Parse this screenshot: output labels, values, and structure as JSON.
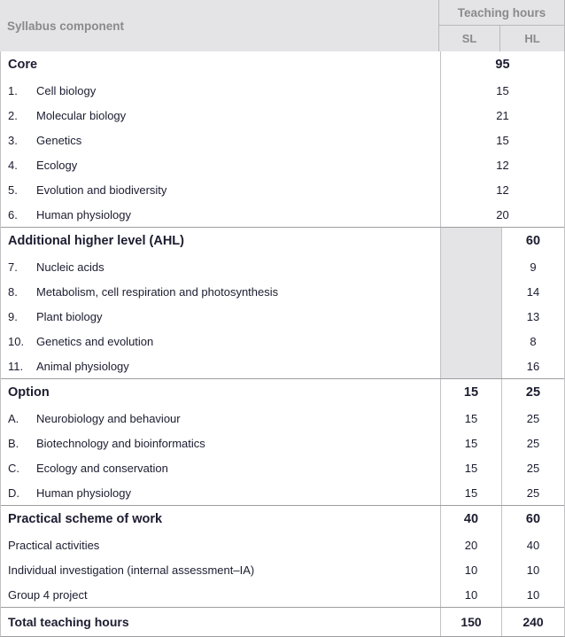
{
  "header": {
    "component_label": "Syllabus component",
    "hours_label": "Teaching hours",
    "sl_label": "SL",
    "hl_label": "HL"
  },
  "colors": {
    "header_bg": "#e4e4e6",
    "header_text": "#8a8a8a",
    "body_text": "#1c1c30",
    "border": "#9e9ea0",
    "shaded_cell": "#e4e4e6"
  },
  "sections": [
    {
      "title": "Core",
      "merged_value": "95",
      "sl_total": "",
      "hl_total": "",
      "sl_shaded": false,
      "items": [
        {
          "index": "1.",
          "label": "Cell biology",
          "merged": "15"
        },
        {
          "index": "2.",
          "label": "Molecular biology",
          "merged": "21"
        },
        {
          "index": "3.",
          "label": "Genetics",
          "merged": "15"
        },
        {
          "index": "4.",
          "label": "Ecology",
          "merged": "12"
        },
        {
          "index": "5.",
          "label": "Evolution and biodiversity",
          "merged": "12"
        },
        {
          "index": "6.",
          "label": "Human physiology",
          "merged": "20"
        }
      ]
    },
    {
      "title": "Additional higher level (AHL)",
      "merged_value": "",
      "sl_total": "",
      "hl_total": "60",
      "sl_shaded": true,
      "items": [
        {
          "index": "7.",
          "label": "Nucleic acids",
          "sl": "",
          "hl": "9"
        },
        {
          "index": "8.",
          "label": "Metabolism, cell respiration and photosynthesis",
          "sl": "",
          "hl": "14"
        },
        {
          "index": "9.",
          "label": "Plant biology",
          "sl": "",
          "hl": "13"
        },
        {
          "index": "10.",
          "label": "Genetics and evolution",
          "sl": "",
          "hl": "8"
        },
        {
          "index": "11.",
          "label": "Animal physiology",
          "sl": "",
          "hl": "16"
        }
      ]
    },
    {
      "title": "Option",
      "merged_value": "",
      "sl_total": "15",
      "hl_total": "25",
      "sl_shaded": false,
      "items": [
        {
          "index": "A.",
          "label": "Neurobiology and behaviour",
          "sl": "15",
          "hl": "25"
        },
        {
          "index": "B.",
          "label": "Biotechnology and bioinformatics",
          "sl": "15",
          "hl": "25"
        },
        {
          "index": "C.",
          "label": "Ecology and conservation",
          "sl": "15",
          "hl": "25"
        },
        {
          "index": "D.",
          "label": "Human physiology",
          "sl": "15",
          "hl": "25"
        }
      ]
    },
    {
      "title": "Practical scheme of work",
      "merged_value": "",
      "sl_total": "40",
      "hl_total": "60",
      "sl_shaded": false,
      "items": [
        {
          "index": "",
          "label": "Practical activities",
          "sl": "20",
          "hl": "40"
        },
        {
          "index": "",
          "label": "Individual investigation (internal assessment–IA)",
          "sl": "10",
          "hl": "10"
        },
        {
          "index": "",
          "label": "Group 4 project",
          "sl": "10",
          "hl": "10"
        }
      ]
    }
  ],
  "total_row": {
    "label": "Total teaching hours",
    "sl": "150",
    "hl": "240"
  }
}
